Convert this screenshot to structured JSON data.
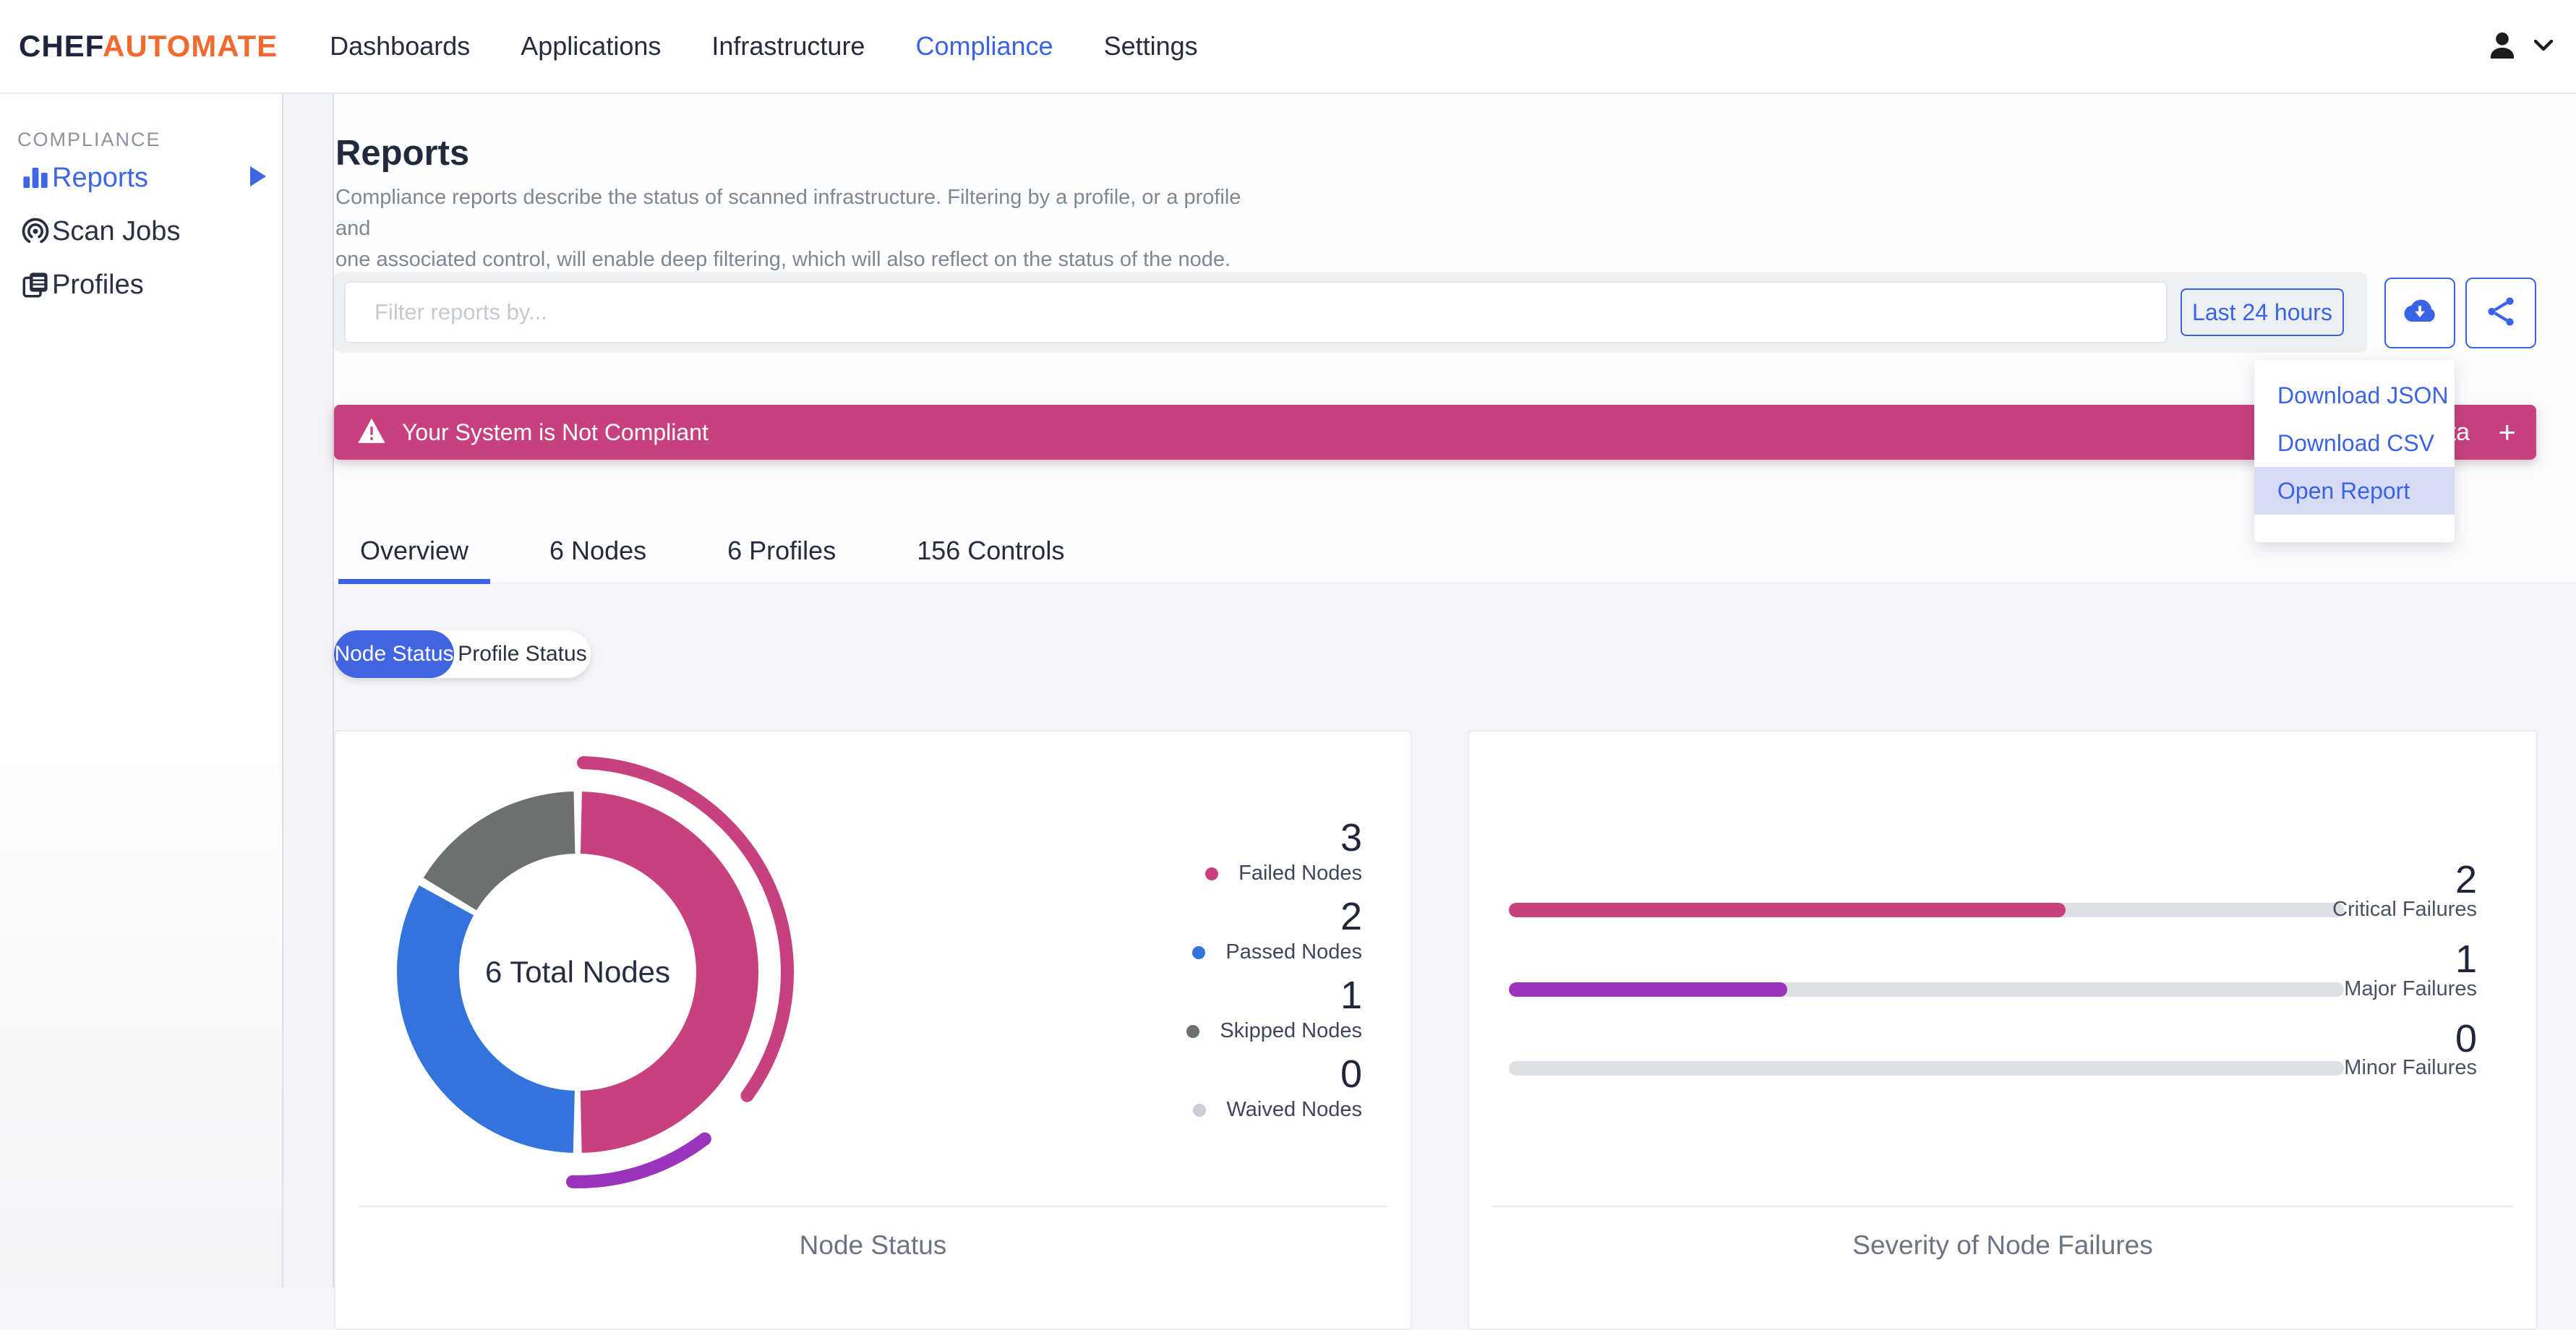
{
  "brand": {
    "chef": "CHEF",
    "automate": "AUTOMATE"
  },
  "nav": {
    "items": [
      "Dashboards",
      "Applications",
      "Infrastructure",
      "Compliance",
      "Settings"
    ],
    "active": "Compliance"
  },
  "sidebar": {
    "section": "COMPLIANCE",
    "items": [
      "Reports",
      "Scan Jobs",
      "Profiles"
    ],
    "active": "Reports"
  },
  "page": {
    "title": "Reports",
    "desc1": "Compliance reports describe the status of scanned infrastructure. Filtering by a profile, or a profile and",
    "desc2": "one associated control, will enable deep filtering, which will also reflect on the status of the node."
  },
  "filter": {
    "placeholder": "Filter reports by...",
    "time_range": "Last 24 hours"
  },
  "banner": {
    "text": "Your System is Not Compliant",
    "fragment_text": "ta",
    "fragment_plus": "+"
  },
  "download_menu": {
    "items": [
      "Download JSON",
      "Download CSV",
      "Open Report"
    ],
    "highlighted": "Open Report"
  },
  "tabs": [
    "Overview",
    "6 Nodes",
    "6 Profiles",
    "156 Controls"
  ],
  "status_toggle": {
    "options": [
      "Node Status",
      "Profile Status"
    ],
    "selected": "Node Status"
  },
  "chart_data": {
    "node_status": {
      "type": "pie",
      "title": "Node Status",
      "center_label": "6 Total Nodes",
      "categories": [
        "Failed Nodes",
        "Passed Nodes",
        "Skipped Nodes",
        "Waived Nodes"
      ],
      "values": [
        3,
        2,
        1,
        0
      ],
      "colors": [
        "#c6417d",
        "#3374dc",
        "#6b716c",
        "#c9ced6"
      ],
      "total": 6,
      "legend_position": "right"
    },
    "severity": {
      "type": "bar",
      "title": "Severity of Node Failures",
      "categories": [
        "Critical Failures",
        "Major Failures",
        "Minor Failures"
      ],
      "values": [
        2,
        1,
        0
      ],
      "xlim": [
        0,
        3
      ],
      "colors": [
        "#c6417d",
        "#9b34bb",
        "#dde0e4"
      ]
    }
  },
  "colors": {
    "accent_blue": "#3b63e8",
    "brand_orange": "#f26a2e",
    "critical_pink": "#c6417d",
    "major_purple": "#9b34bb",
    "passed_blue": "#3374dc",
    "skipped_gray": "#6b716c",
    "waived_gray": "#c9ced6",
    "track_gray": "#dde0e4"
  }
}
